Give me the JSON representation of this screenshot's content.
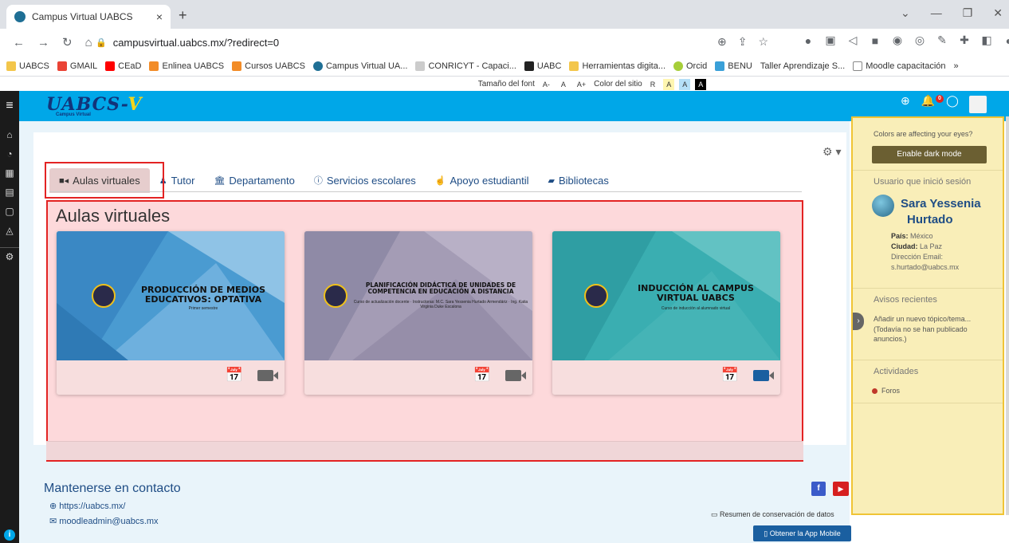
{
  "browser": {
    "tab_title": "Campus Virtual UABCS",
    "tab_close": "×",
    "new_tab": "+",
    "url": "campusvirtual.uabcs.mx/?redirect=0",
    "bookmarks": [
      "UABCS",
      "GMAIL",
      "CEaD",
      "Enlinea UABCS",
      "Cursos UABCS",
      "Campus Virtual UA...",
      "CONRICYT - Capaci...",
      "UABC",
      "Herramientas digita...",
      "Orcid",
      "BENU",
      "Taller Aprendizaje S...",
      "Moodle capacitación"
    ],
    "bookmark_more": "»"
  },
  "accessibility": {
    "font_label": "Tamaño del font",
    "font_minus": "A-",
    "font_reset": "A",
    "font_plus": "A+",
    "color_label": "Color del sitio",
    "color_r": "R",
    "color_a1": "A",
    "color_a2": "A",
    "color_a3": "A"
  },
  "header": {
    "logo_text": "UABCS-",
    "logo_v": "V",
    "logo_sub": "Campus Virtual",
    "notif_count": "0"
  },
  "tabs": [
    {
      "label": "Aulas virtuales",
      "icon": "video-camera-icon"
    },
    {
      "label": "Tutor",
      "icon": "user-icon"
    },
    {
      "label": "Departamento",
      "icon": "institution-icon"
    },
    {
      "label": "Servicios escolares",
      "icon": "info-circle-icon"
    },
    {
      "label": "Apoyo estudiantil",
      "icon": "hand-pointer-icon"
    },
    {
      "label": "Bibliotecas",
      "icon": "book-icon"
    }
  ],
  "section_title": "Aulas virtuales",
  "courses": [
    {
      "title": "PRODUCCIÓN DE MEDIOS EDUCATIVOS: OPTATIVA",
      "subtitle": "Primer semestre",
      "color": "#3f92c9"
    },
    {
      "title": "PLANIFICACIÓN DIDÁCTICA DE UNIDADES DE COMPETENCIA EN EDUCACIÓN A DISTANCIA",
      "subtitle": "Curso de actualización docente · Instructoras: M.C. Sara Yessenia Hurtado Armendáriz · Ing. Katia Virginia Duke Escalona",
      "color": "#9e96b0"
    },
    {
      "title": "INDUCCIÓN AL CAMPUS VIRTUAL UABCS",
      "subtitle": "Curso de inducción al alumnado virtual",
      "color": "#32a9ad"
    }
  ],
  "footer": {
    "contact_title": "Mantenerse en contacto",
    "website": "https://uabcs.mx/",
    "email": "moodleadmin@uabcs.mx",
    "privacy": "Resumen de conservación de datos",
    "app_button": "Obtener la App Mobile",
    "fb": "f"
  },
  "drawer": {
    "dark_question": "Colors are affecting your eyes?",
    "dark_button": "Enable dark mode",
    "user_section": "Usuario que inició sesión",
    "user_name_1": "Sara Yessenia",
    "user_name_2": "Hurtado",
    "country_label": "País:",
    "country": "México",
    "city_label": "Ciudad:",
    "city": "La Paz",
    "email_label": "Dirección Email:",
    "email": "s.hurtado@uabcs.mx",
    "news_section": "Avisos recientes",
    "news_add": "Añadir un nuevo tópico/tema...",
    "news_empty": "(Todavía no se han publicado anuncios.)",
    "activities_section": "Actividades",
    "activity_1": "Foros"
  }
}
